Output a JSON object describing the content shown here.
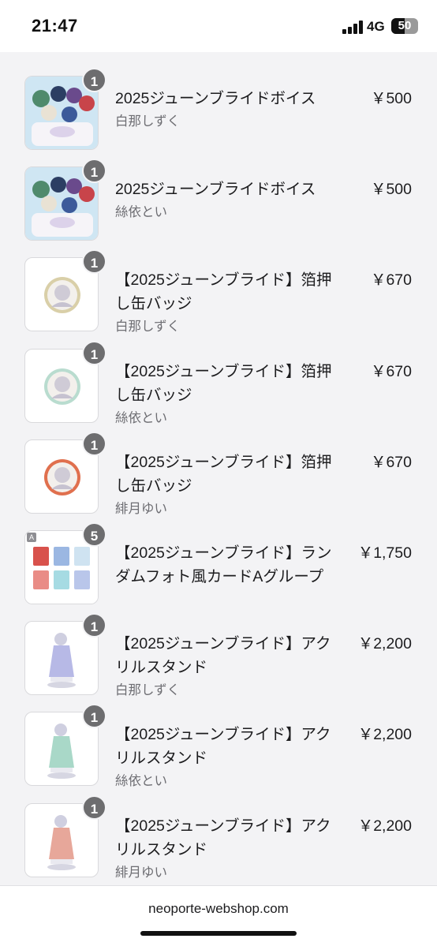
{
  "status": {
    "time": "21:47",
    "network": "4G",
    "battery": "50",
    "battery_fraction": 0.5
  },
  "browser": {
    "url": "neoporte-webshop.com"
  },
  "items": [
    {
      "qty": "1",
      "title": "2025ジューンブライドボイス",
      "variant": "白那しずく",
      "price": "￥500",
      "thumb": "group-art"
    },
    {
      "qty": "1",
      "title": "2025ジューンブライドボイス",
      "variant": "絲依とい",
      "price": "￥500",
      "thumb": "group-art"
    },
    {
      "qty": "1",
      "title": "【2025ジューンブライド】箔押し缶バッジ",
      "variant": "白那しずく",
      "price": "￥670",
      "thumb": "badge",
      "badge_color": "#d9cfa8"
    },
    {
      "qty": "1",
      "title": "【2025ジューンブライド】箔押し缶バッジ",
      "variant": "絲依とい",
      "price": "￥670",
      "thumb": "badge",
      "badge_color": "#b9dccf"
    },
    {
      "qty": "1",
      "title": "【2025ジューンブライド】箔押し缶バッジ",
      "variant": "緋月ゆい",
      "price": "￥670",
      "thumb": "badge",
      "badge_color": "#e0704e"
    },
    {
      "qty": "5",
      "title": "【2025ジューンブライド】ランダムフォト風カードAグループ",
      "variant": "",
      "price": "￥1,750",
      "thumb": "cards",
      "tag": "A"
    },
    {
      "qty": "1",
      "title": "【2025ジューンブライド】アクリルスタンド",
      "variant": "白那しずく",
      "price": "￥2,200",
      "thumb": "stand",
      "stand_color": "#b7b9e6"
    },
    {
      "qty": "1",
      "title": "【2025ジューンブライド】アクリルスタンド",
      "variant": "絲依とい",
      "price": "￥2,200",
      "thumb": "stand",
      "stand_color": "#a9d8c8"
    },
    {
      "qty": "1",
      "title": "【2025ジューンブライド】アクリルスタンド",
      "variant": "緋月ゆい",
      "price": "￥2,200",
      "thumb": "stand",
      "stand_color": "#e7a79a"
    }
  ]
}
